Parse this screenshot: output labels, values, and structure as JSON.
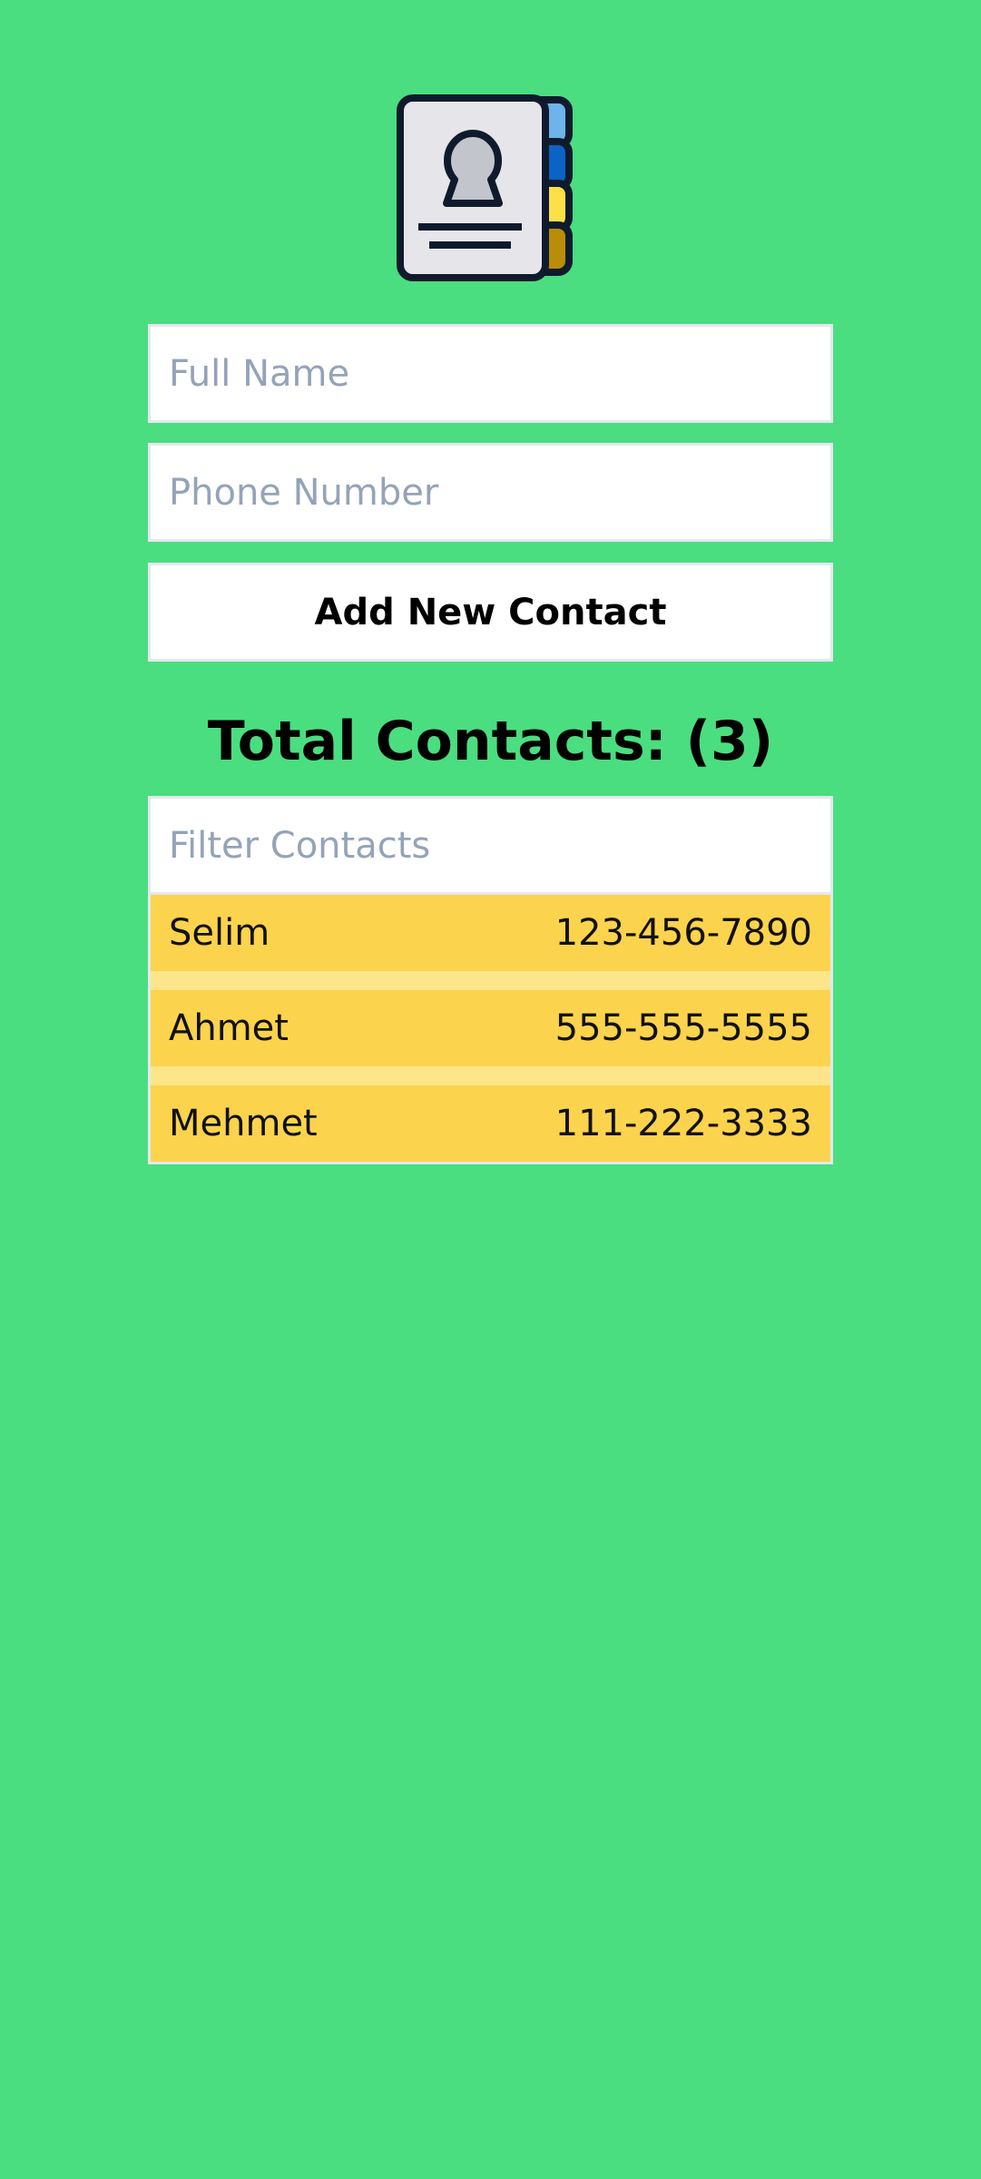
{
  "app": {
    "logo_icon": "contact-book-icon"
  },
  "form": {
    "name_placeholder": "Full Name",
    "phone_placeholder": "Phone Number",
    "add_button_label": "Add New Contact"
  },
  "summary": {
    "total_label": "Total Contacts: (3)"
  },
  "filter": {
    "placeholder": "Filter Contacts"
  },
  "contacts": [
    {
      "name": "Selim",
      "phone": "123-456-7890"
    },
    {
      "name": "Ahmet",
      "phone": "555-555-5555"
    },
    {
      "name": "Mehmet",
      "phone": "111-222-3333"
    }
  ],
  "colors": {
    "background": "#4ade80",
    "contact_row": "#fcd34d",
    "contact_row_gap": "#fde68a",
    "placeholder": "#94a3b8",
    "tab_light_blue": "#6cb4ea",
    "tab_blue": "#0b63c5",
    "tab_yellow": "#fde047",
    "tab_gold": "#b98d08"
  }
}
